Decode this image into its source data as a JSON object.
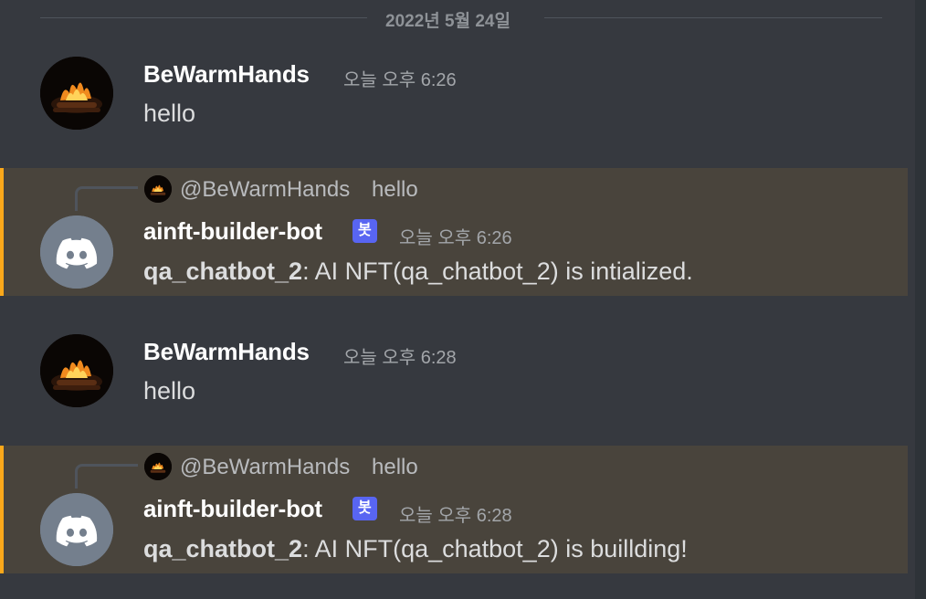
{
  "date_divider": "2022년 5월 24일",
  "messages": [
    {
      "author": "BeWarmHands",
      "timestamp": "오늘 오후 6:26",
      "content": "hello",
      "avatar_icon": "fireplace-avatar"
    },
    {
      "reply": {
        "author": "@BeWarmHands",
        "text": "hello"
      },
      "author": "ainft-builder-bot",
      "bot_tag": "봇",
      "timestamp": "오늘 오후 6:26",
      "content_prefix": "qa_chatbot_2",
      "content_rest": ": AI NFT(qa_chatbot_2) is intialized.",
      "avatar_icon": "discord-logo-avatar"
    },
    {
      "author": "BeWarmHands",
      "timestamp": "오늘 오후 6:28",
      "content": "hello",
      "avatar_icon": "fireplace-avatar"
    },
    {
      "reply": {
        "author": "@BeWarmHands",
        "text": "hello"
      },
      "author": "ainft-builder-bot",
      "bot_tag": "봇",
      "timestamp": "오늘 오후 6:28",
      "content_prefix": "qa_chatbot_2",
      "content_rest": ": AI NFT(qa_chatbot_2) is buillding!",
      "avatar_icon": "discord-logo-avatar"
    }
  ],
  "colors": {
    "background": "#36393f",
    "mention_highlight_bg": "#49443c",
    "mention_highlight_bar": "#faa81a",
    "bot_tag": "#5865f2",
    "bot_avatar": "#747f8d"
  }
}
